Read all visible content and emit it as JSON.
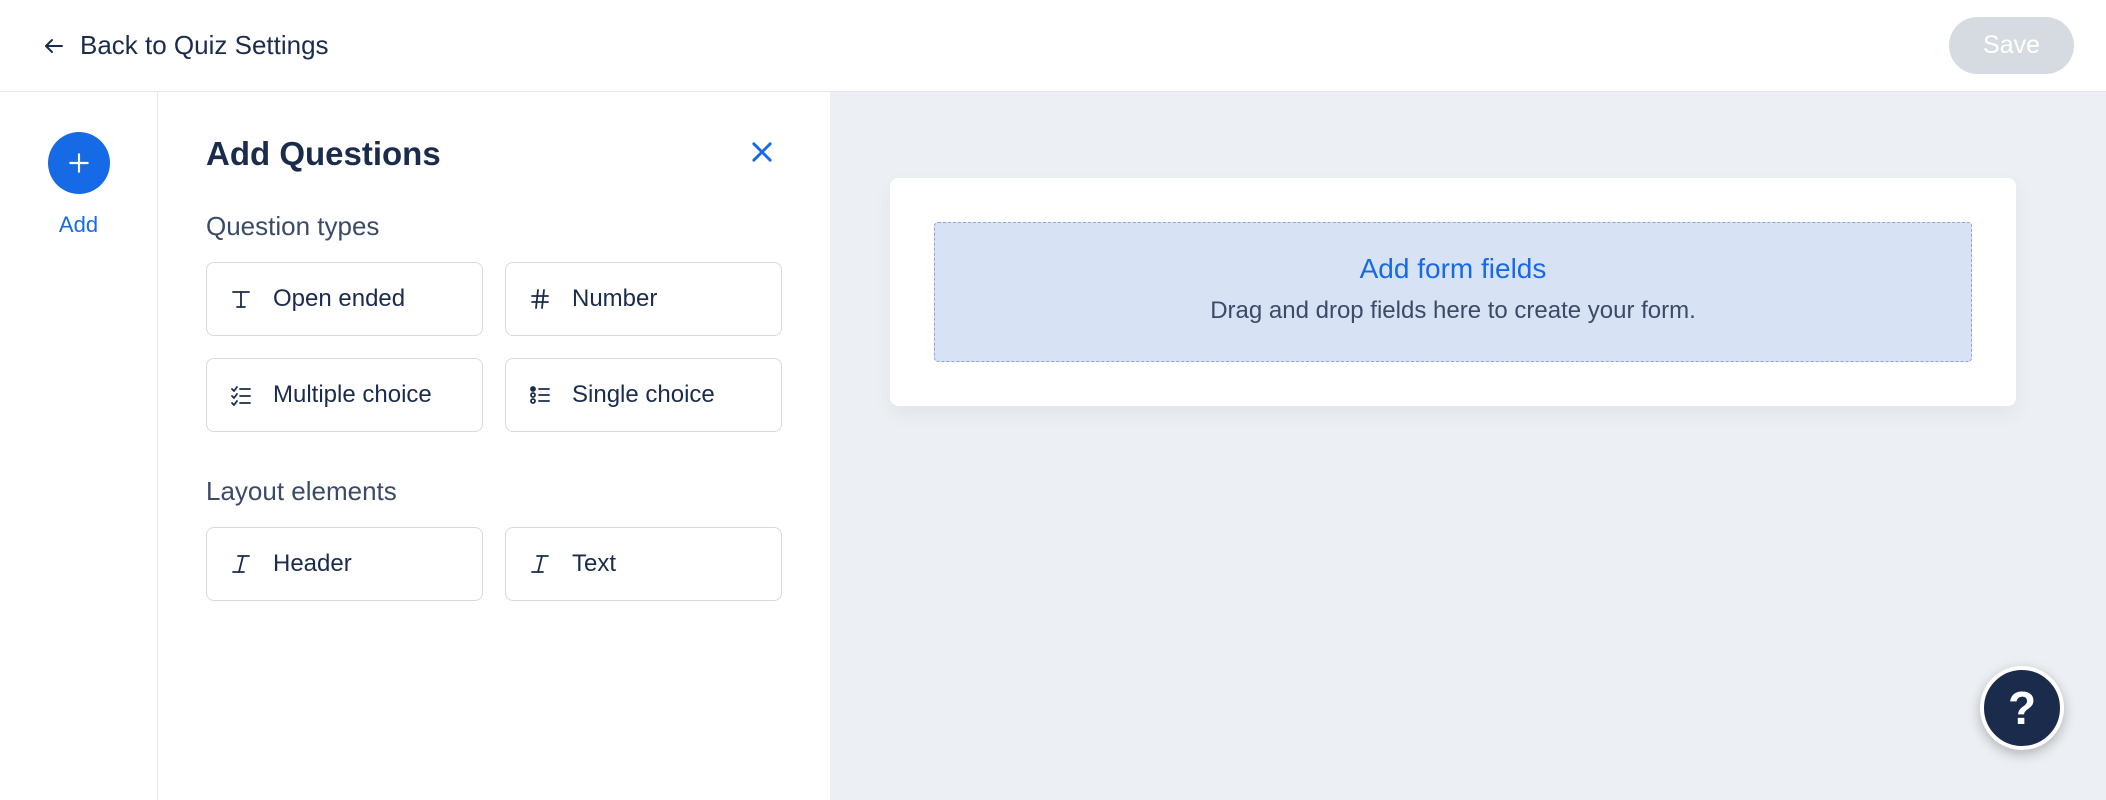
{
  "topbar": {
    "back_label": "Back to Quiz Settings",
    "save_label": "Save"
  },
  "rail": {
    "add_label": "Add"
  },
  "panel": {
    "title": "Add Questions",
    "sections": {
      "question_types": {
        "label": "Question types",
        "items": [
          {
            "icon": "text-type",
            "label": "Open ended"
          },
          {
            "icon": "hash",
            "label": "Number"
          },
          {
            "icon": "checklist",
            "label": "Multiple choice"
          },
          {
            "icon": "radio-list",
            "label": "Single choice"
          }
        ]
      },
      "layout_elements": {
        "label": "Layout elements",
        "items": [
          {
            "icon": "italic-t",
            "label": "Header"
          },
          {
            "icon": "italic-t",
            "label": "Text"
          }
        ]
      }
    }
  },
  "canvas": {
    "dropzone": {
      "title": "Add form fields",
      "subtitle": "Drag and drop fields here to create your form."
    }
  },
  "help": {
    "glyph": "?"
  },
  "colors": {
    "accent": "#176ae5",
    "dark": "#1a2b4c",
    "canvas_bg": "#eceff3",
    "dropzone_bg": "#d7e2f4"
  }
}
